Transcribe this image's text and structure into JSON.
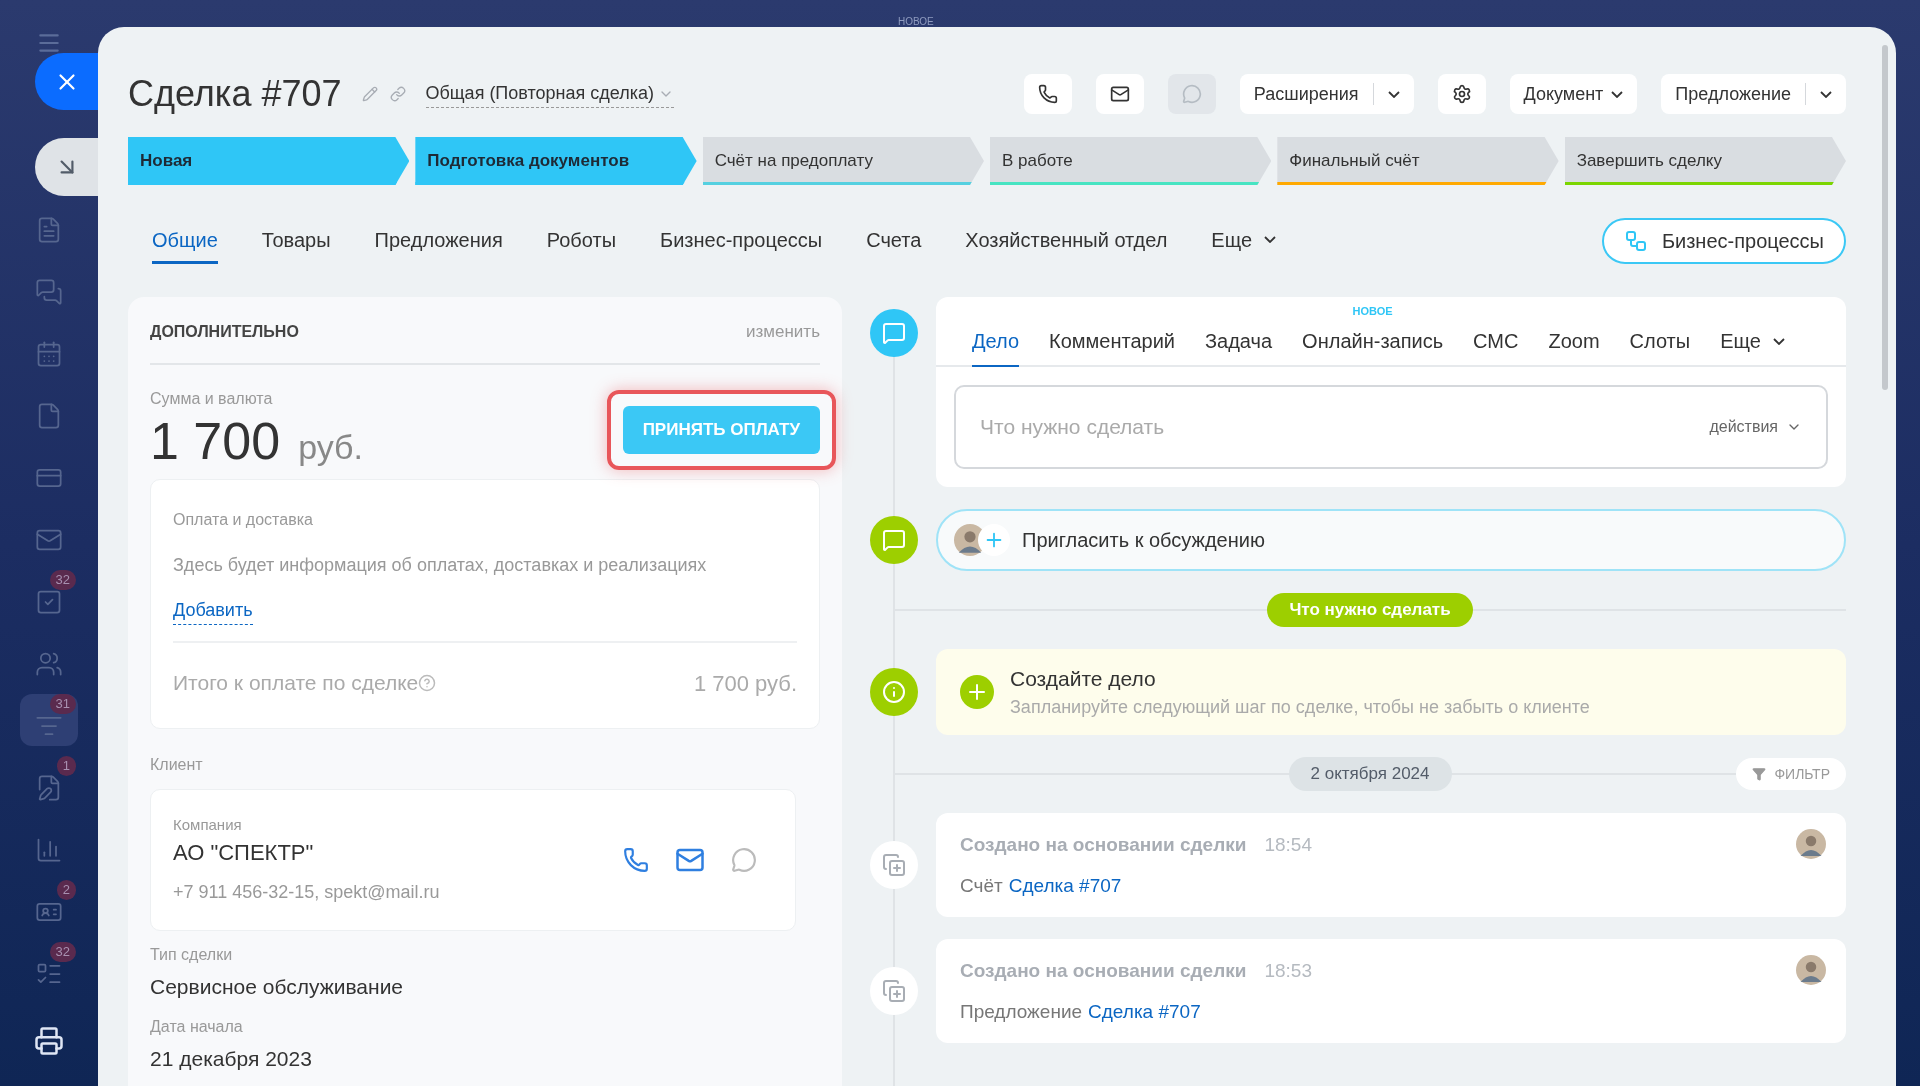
{
  "overlay_label": "НОВОЕ",
  "sidebar": {
    "items": [
      {
        "kind": "document",
        "selected": false
      },
      {
        "kind": "chats",
        "selected": false
      },
      {
        "kind": "calendar",
        "selected": false
      },
      {
        "kind": "file",
        "selected": false
      },
      {
        "kind": "card",
        "selected": false
      },
      {
        "kind": "mail",
        "selected": false
      },
      {
        "kind": "tasks",
        "badge": "32",
        "selected": false
      },
      {
        "kind": "contacts",
        "selected": false
      },
      {
        "kind": "funnel",
        "badge": "31",
        "selected": true
      },
      {
        "kind": "edit",
        "badge": "1",
        "selected": false
      },
      {
        "kind": "chart",
        "selected": false
      },
      {
        "kind": "idcard",
        "badge": "2",
        "selected": false
      },
      {
        "kind": "list",
        "badge": "32",
        "selected": false
      }
    ]
  },
  "header": {
    "title": "Сделка #707",
    "category": "Общая (Повторная сделка)",
    "buttons": [
      {
        "kind": "phone",
        "disabled": false
      },
      {
        "kind": "mail",
        "disabled": false
      },
      {
        "kind": "chat",
        "disabled": true
      },
      {
        "kind": "split",
        "label": "Расширения"
      },
      {
        "kind": "settings",
        "disabled": false
      },
      {
        "kind": "dropdown",
        "label": "Документ"
      },
      {
        "kind": "split",
        "label": "Предложение"
      }
    ]
  },
  "stages": [
    {
      "label": "Новая",
      "color": "#2fc6f6",
      "passed": true
    },
    {
      "label": "Подготовка документов",
      "color": "#2fc6f6",
      "passed": true
    },
    {
      "label": "Счёт на предоплату",
      "color": "#55d0e0",
      "passed": false
    },
    {
      "label": "В работе",
      "color": "#47e4c2",
      "passed": false
    },
    {
      "label": "Финальный счёт",
      "color": "#ffa900",
      "passed": false
    },
    {
      "label": "Завершить сделку",
      "color": "#7bd500",
      "passed": false
    }
  ],
  "tabs": [
    {
      "label": "Общие",
      "selected": true
    },
    {
      "label": "Товары",
      "selected": false
    },
    {
      "label": "Предложения",
      "selected": false
    },
    {
      "label": "Роботы",
      "selected": false
    },
    {
      "label": "Бизнес-процессы",
      "selected": false
    },
    {
      "label": "Счета",
      "selected": false
    },
    {
      "label": "Хозяйственный отдел",
      "selected": false
    },
    {
      "label": "Еще",
      "selected": false,
      "menu": true
    }
  ],
  "bp_button": "Бизнес-процессы",
  "details": {
    "section": "ДОПОЛНИТЕЛЬНО",
    "edit": "изменить",
    "amount_label": "Сумма и валюта",
    "amount": "1 700",
    "currency": "руб.",
    "pay_button": {
      "label": "ПРИНЯТЬ ОПЛАТУ",
      "highlighted": true
    },
    "payment": {
      "title": "Оплата и доставка",
      "info": "Здесь будет информация об оплатах, доставках и реализациях",
      "add": "Добавить",
      "total_label": "Итого к оплате по сделке",
      "total": "1 700 руб."
    },
    "client_label": "Клиент",
    "client": {
      "type": "Компания",
      "name": "АО \"СПЕКТР\"",
      "contacts": "+7 911 456-32-15, spekt@mail.ru"
    },
    "fields": [
      {
        "label": "Тип сделки",
        "value": "Сервисное обслуживание"
      },
      {
        "label": "Дата начала",
        "value": "21 декабря 2023"
      }
    ]
  },
  "timeline": {
    "tabs": [
      {
        "label": "Дело",
        "selected": true
      },
      {
        "label": "Комментарий",
        "selected": false
      },
      {
        "label": "Задача",
        "selected": false
      },
      {
        "label": "Онлайн-запись",
        "selected": false,
        "badge": "НОВОЕ"
      },
      {
        "label": "СМС",
        "selected": false
      },
      {
        "label": "Zoom",
        "selected": false
      },
      {
        "label": "Слоты",
        "selected": false
      },
      {
        "label": "Еще",
        "selected": false,
        "menu": true
      }
    ],
    "placeholder": "Что нужно сделать",
    "actions": "действия",
    "invite": "Пригласить к обсуждению",
    "todo_pill": "Что нужно сделать",
    "create": {
      "title": "Создайте дело",
      "text": "Запланируйте следующий шаг по сделке, чтобы не забыть о клиенте"
    },
    "date": "2 октября 2024",
    "filter": "ФИЛЬТР",
    "entries": [
      {
        "title": "Создано на основании сделки",
        "time": "18:54",
        "type": "Счёт",
        "link": "Сделка #707"
      },
      {
        "title": "Создано на основании сделки",
        "time": "18:53",
        "type": "Предложение",
        "link": "Сделка #707"
      }
    ]
  }
}
